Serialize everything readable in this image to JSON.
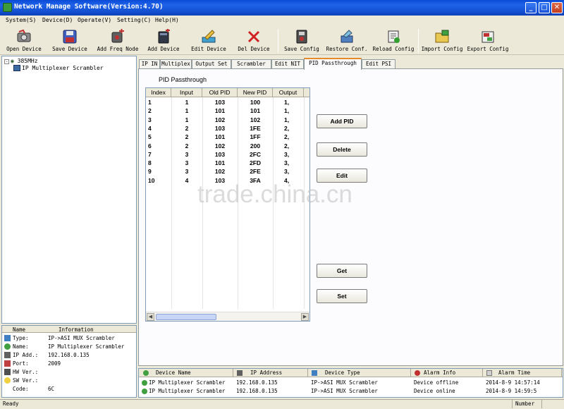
{
  "window": {
    "title": "Network Manage Software(Version:4.70)",
    "minimize": "_",
    "maximize": "□",
    "close": "✕"
  },
  "menu": [
    "System(S)",
    "Device(D)",
    "Operate(V)",
    "Setting(C)",
    "Help(H)"
  ],
  "toolbar": {
    "open_device": "Open Device",
    "save_device": "Save Device",
    "add_freq_node": "Add Freq Node",
    "add_device": "Add Device",
    "edit_device": "Edit Device",
    "del_device": "Del Device",
    "save_config": "Save Config",
    "restore_conf": "Restore Conf.",
    "reload_config": "Reload Config",
    "import_config": "Import Config",
    "export_config": "Export Config"
  },
  "tree": {
    "root": "385MHz",
    "child": "IP Multiplexer Scrambler"
  },
  "info": {
    "header_name": "Name",
    "header_info": "Information",
    "rows": [
      {
        "name": "Type:",
        "value": "IP->ASI MUX Scrambler"
      },
      {
        "name": "Name:",
        "value": "IP Multiplexer Scrambler"
      },
      {
        "name": "IP Add.:",
        "value": "192.168.0.135"
      },
      {
        "name": "Port:",
        "value": "2009"
      },
      {
        "name": "HW Ver.:",
        "value": ""
      },
      {
        "name": "SW Ver.:",
        "value": ""
      },
      {
        "name": "Code:",
        "value": "6C"
      }
    ]
  },
  "tabs": [
    "IP IN",
    "Multiplex",
    "Output Set",
    "Scrambler",
    "Edit NIT",
    "PID Passthrough",
    "Edit PSI"
  ],
  "active_tab": "PID Passthrough",
  "pid_panel": {
    "title": "PID Passthrough",
    "columns": [
      "Index",
      "Input",
      "Old PID",
      "New PID",
      "Output"
    ],
    "rows": [
      [
        "1",
        "1",
        "103",
        "100",
        "1,"
      ],
      [
        "2",
        "1",
        "101",
        "101",
        "1,"
      ],
      [
        "3",
        "1",
        "102",
        "102",
        "1,"
      ],
      [
        "4",
        "2",
        "103",
        "1FE",
        "2,"
      ],
      [
        "5",
        "2",
        "101",
        "1FF",
        "2,"
      ],
      [
        "6",
        "2",
        "102",
        "200",
        "2,"
      ],
      [
        "7",
        "3",
        "103",
        "2FC",
        "3,"
      ],
      [
        "8",
        "3",
        "101",
        "2FD",
        "3,"
      ],
      [
        "9",
        "3",
        "102",
        "2FE",
        "3,"
      ],
      [
        "10",
        "4",
        "103",
        "3FA",
        "4,"
      ]
    ],
    "buttons": {
      "add_pid": "Add PID",
      "delete": "Delete",
      "edit": "Edit",
      "get": "Get",
      "set": "Set"
    }
  },
  "device_list": {
    "headers": [
      "Device Name",
      "IP Address",
      "Device Type",
      "Alarm Info",
      "Alarm Time"
    ],
    "rows": [
      [
        "IP Multiplexer Scrambler",
        "192.168.0.135",
        "IP->ASI MUX Scrambler",
        "Device offline",
        "2014-8-9 14:57:14"
      ],
      [
        "IP Multiplexer Scrambler",
        "192.168.0.135",
        "IP->ASI MUX Scrambler",
        "Device online",
        "2014-8-9 14:59:5"
      ]
    ]
  },
  "status": {
    "left": "Ready",
    "right": "Number"
  },
  "watermark": "trade.china.cn"
}
